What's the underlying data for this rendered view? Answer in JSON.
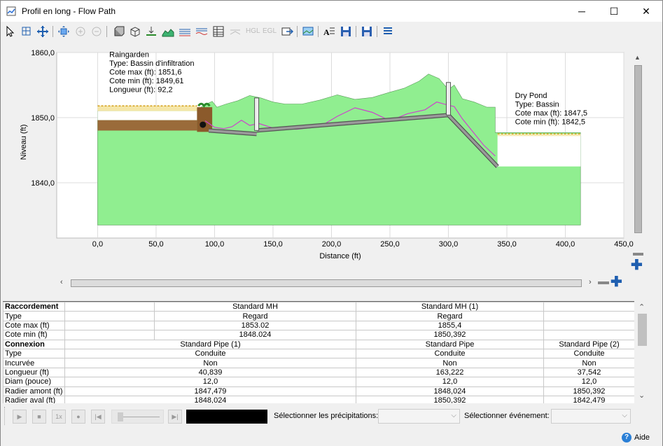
{
  "window": {
    "title": "Profil en long - Flow Path",
    "minimize": "─",
    "maximize": "☐",
    "close": "✕"
  },
  "toolbar": {
    "hgl": "HGL",
    "egl": "EGL"
  },
  "chart_data": {
    "type": "area",
    "xlabel": "Distance (ft)",
    "ylabel": "Niveau (ft)",
    "xlim": [
      -35,
      450
    ],
    "ylim": [
      1831.5,
      1860.0
    ],
    "x_ticks": [
      "0,0",
      "50,0",
      "100,0",
      "150,0",
      "200,0",
      "250,0",
      "300,0",
      "350,0",
      "400,0",
      "450,0"
    ],
    "x_tick_values": [
      0,
      50,
      100,
      150,
      200,
      250,
      300,
      350,
      400,
      450
    ],
    "y_ticks": [
      "1840,0",
      "1850,0",
      "1860,0"
    ],
    "y_tick_values": [
      1840,
      1850,
      1860
    ],
    "ground_surface": [
      [
        0,
        1851
      ],
      [
        85,
        1851.2
      ],
      [
        92,
        1852
      ],
      [
        98,
        1852.5
      ],
      [
        102,
        1851.6
      ],
      [
        110,
        1852.1
      ],
      [
        120,
        1852.6
      ],
      [
        130,
        1853.4
      ],
      [
        140,
        1853
      ],
      [
        150,
        1852.4
      ],
      [
        160,
        1852.1
      ],
      [
        175,
        1852.1
      ],
      [
        190,
        1852.7
      ],
      [
        205,
        1853.5
      ],
      [
        220,
        1852.8
      ],
      [
        235,
        1853.1
      ],
      [
        250,
        1853.9
      ],
      [
        262,
        1854.5
      ],
      [
        275,
        1855.6
      ],
      [
        283,
        1856.7
      ],
      [
        292,
        1856
      ],
      [
        300,
        1854.3
      ],
      [
        305,
        1855
      ],
      [
        312,
        1852.9
      ],
      [
        322,
        1852.4
      ],
      [
        333,
        1851.6
      ],
      [
        340,
        1851.6
      ],
      [
        340,
        1847.7
      ],
      [
        413,
        1847.7
      ],
      [
        413,
        1833.5
      ],
      [
        0,
        1833.5
      ]
    ],
    "hgl_line": [
      [
        92,
        1849.5
      ],
      [
        100,
        1848.5
      ],
      [
        108,
        1848.3
      ],
      [
        115,
        1848.6
      ],
      [
        123,
        1849.6
      ],
      [
        130,
        1848.8
      ],
      [
        138,
        1849.1
      ],
      [
        150,
        1848.4
      ],
      [
        170,
        1848.2
      ],
      [
        190,
        1848.6
      ],
      [
        205,
        1850.2
      ],
      [
        220,
        1851.5
      ],
      [
        235,
        1850.8
      ],
      [
        250,
        1849.5
      ],
      [
        265,
        1850.6
      ],
      [
        280,
        1851.2
      ],
      [
        290,
        1852.4
      ],
      [
        300,
        1851.9
      ],
      [
        305,
        1851.7
      ],
      [
        312,
        1849.8
      ],
      [
        330,
        1845.8
      ],
      [
        340,
        1844.1
      ]
    ],
    "pipes": [
      {
        "x": [
          95,
          136
        ],
        "y": [
          1848.024,
          1847.479
        ]
      },
      {
        "x": [
          136,
          300
        ],
        "y": [
          1848.024,
          1850.392
        ]
      },
      {
        "x": [
          300,
          342
        ],
        "y": [
          1850.392,
          1842.479
        ]
      }
    ],
    "manholes": [
      {
        "x": 136,
        "y_bottom": 1848.024,
        "y_top": 1853.02
      },
      {
        "x": 300,
        "y_bottom": 1850.392,
        "y_top": 1855.4
      }
    ],
    "raingarden": {
      "x": [
        0,
        85
      ],
      "top": 1851.6,
      "bottom": 1849.61
    },
    "pond": {
      "x": [
        342,
        413
      ],
      "max": 1847.5,
      "min": 1842.5
    },
    "annotations": [
      {
        "lines": [
          "Raingarden",
          "Type: Bassin d'infiltration",
          "Cote max (ft): 1851,6",
          "Cote min (ft): 1849,61",
          "Longueur (ft): 92,2"
        ],
        "x": 10,
        "y": 1859.3
      },
      {
        "lines": [
          "Dry Pond",
          "Type: Bassin",
          "Cote max (ft):  1847,5",
          "Cote min (ft):  1842,5"
        ],
        "x": 357,
        "y": 1853.0
      }
    ]
  },
  "table": {
    "sections": [
      {
        "name": "Raccordement",
        "cols": [
          "",
          "Standard MH",
          "Standard MH (1)"
        ],
        "rows": [
          {
            "label": "Type",
            "values": [
              "",
              "Regard",
              "Regard"
            ]
          },
          {
            "label": "Cote max (ft)",
            "values": [
              "",
              "1853.02",
              "1855,4"
            ]
          },
          {
            "label": "Cote min (ft)",
            "values": [
              "",
              "1848.024",
              "1850,392"
            ]
          }
        ]
      },
      {
        "name": "Connexion",
        "cols": [
          "Standard Pipe (1)",
          "Standard Pipe",
          "Standard Pipe (2)"
        ],
        "rows": [
          {
            "label": "Type",
            "values": [
              "Conduite",
              "Conduite",
              "Conduite"
            ]
          },
          {
            "label": "Incurvée",
            "values": [
              "Non",
              "Non",
              "Non"
            ]
          },
          {
            "label": "Longueur (ft)",
            "values": [
              "40,839",
              "163,222",
              "37,542"
            ]
          },
          {
            "label": "Diam (pouce)",
            "values": [
              "12,0",
              "12,0",
              "12,0"
            ]
          },
          {
            "label": "Radier amont (ft)",
            "values": [
              "1847,479",
              "1848,024",
              "1850,392"
            ]
          },
          {
            "label": "Radier aval (ft)",
            "values": [
              "1848,024",
              "1850,392",
              "1842,479"
            ]
          }
        ]
      }
    ]
  },
  "bottom": {
    "speed": "1x",
    "precip_label": "Sélectionner les précipitations:",
    "event_label": "Sélectionner événement:"
  },
  "status": {
    "help": "Aide"
  },
  "colors": {
    "ground": "#90ee90",
    "hgl": "#cc44cc",
    "pipe": "#777777",
    "plot_bg": "#ffffff"
  }
}
